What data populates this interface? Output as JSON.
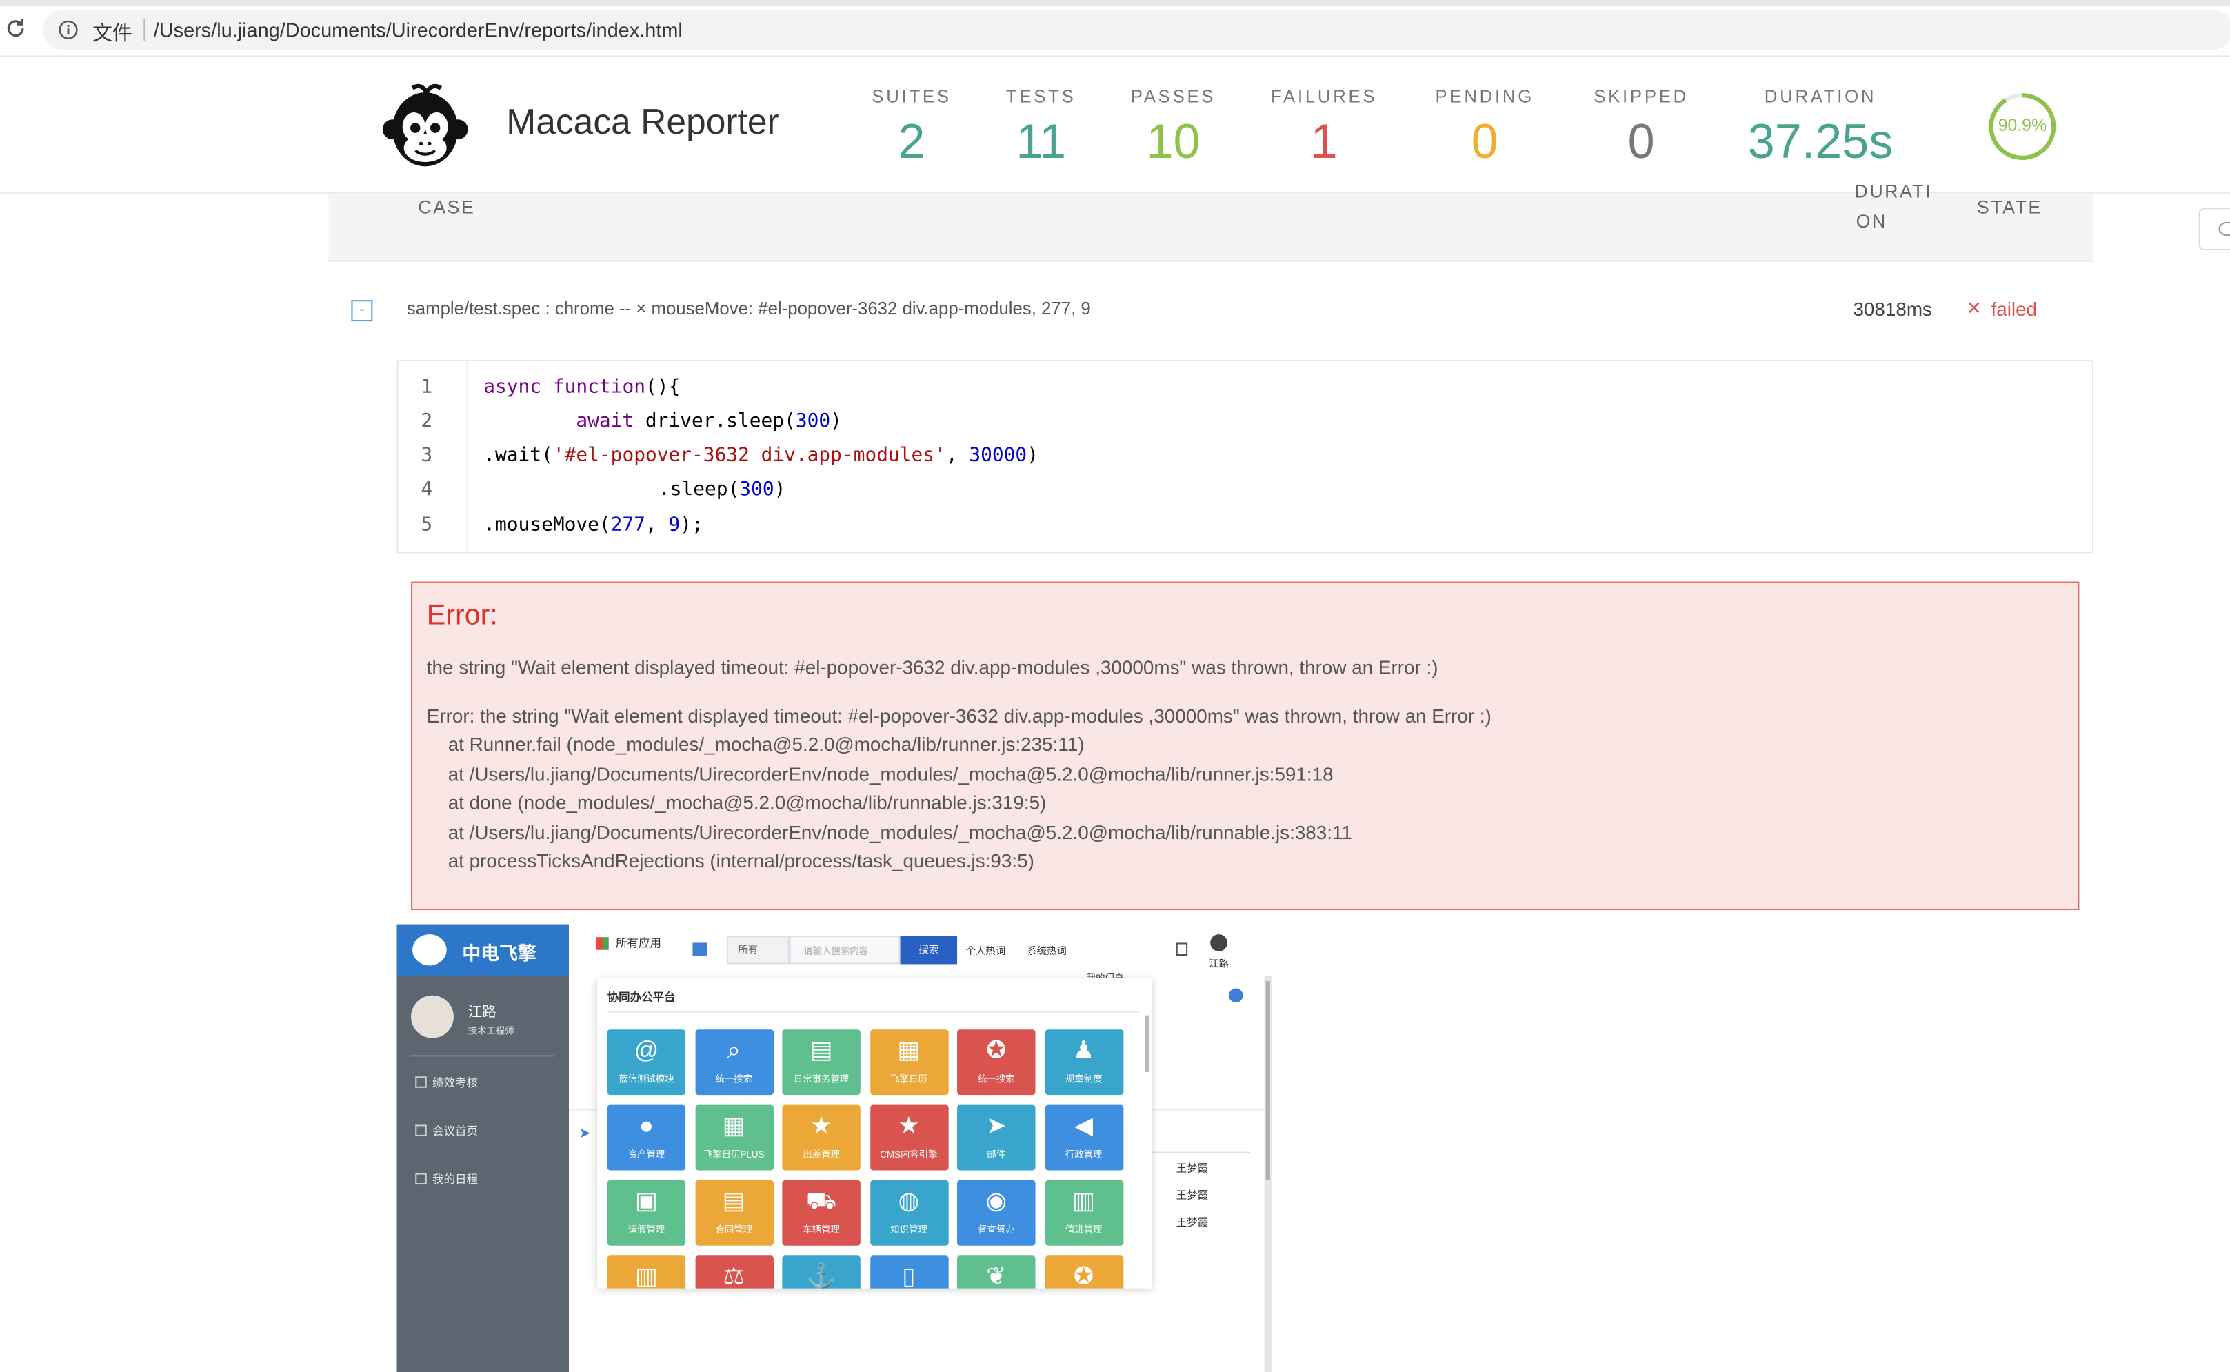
{
  "browser": {
    "file_label": "文件",
    "url": "/Users/lu.jiang/Documents/UirecorderEnv/reports/index.html"
  },
  "header": {
    "title": "Macaca Reporter",
    "stats": [
      {
        "label": "SUITES",
        "value": "2",
        "color": "#4aa38f"
      },
      {
        "label": "TESTS",
        "value": "11",
        "color": "#4aa38f"
      },
      {
        "label": "PASSES",
        "value": "10",
        "color": "#8fc24b"
      },
      {
        "label": "FAILURES",
        "value": "1",
        "color": "#d9534f"
      },
      {
        "label": "PENDING",
        "value": "0",
        "color": "#f0ad2e"
      },
      {
        "label": "SKIPPED",
        "value": "0",
        "color": "#777777"
      },
      {
        "label": "DURATION",
        "value": "37.25s",
        "color": "#4aa38f"
      }
    ],
    "pass_rate": "90.9%",
    "pass_rate_fraction": 0.909
  },
  "table": {
    "col_case": "CASE",
    "col_duration_top": "DURATI",
    "col_duration_bottom": "ON",
    "col_state": "STATE"
  },
  "test": {
    "toggle": "-",
    "title": "sample/test.spec : chrome -- × mouseMove: #el-popover-3632 div.app-modules, 277, 9",
    "duration": "30818ms",
    "state_icon": "×",
    "state": "failed"
  },
  "code": {
    "line_numbers": [
      "1",
      "2",
      "3",
      "4",
      "5"
    ],
    "l1_kw": "async",
    "l1_kw2": "function",
    "l1_rest": "(){",
    "l2_kw": "await",
    "l2_rest": " driver.sleep(",
    "l2_num": "300",
    "l2_end": ")",
    "l3_a": ".wait(",
    "l3_str": "'#el-popover-3632 div.app-modules'",
    "l3_b": ", ",
    "l3_num": "30000",
    "l3_c": ")",
    "l4_a": ".sleep(",
    "l4_num": "300",
    "l4_b": ")",
    "l5_a": ".mouseMove(",
    "l5_num1": "277",
    "l5_b": ", ",
    "l5_num2": "9",
    "l5_c": ");"
  },
  "error": {
    "heading": "Error:",
    "message": "the string \"Wait element displayed timeout: #el-popover-3632 div.app-modules ,30000ms\" was thrown, throw an Error :)",
    "stack": [
      "Error: the string \"Wait element displayed timeout: #el-popover-3632 div.app-modules ,30000ms\" was thrown, throw an Error :)",
      "    at Runner.fail (node_modules/_mocha@5.2.0@mocha/lib/runner.js:235:11)",
      "    at /Users/lu.jiang/Documents/UirecorderEnv/node_modules/_mocha@5.2.0@mocha/lib/runner.js:591:18",
      "    at done (node_modules/_mocha@5.2.0@mocha/lib/runnable.js:319:5)",
      "    at /Users/lu.jiang/Documents/UirecorderEnv/node_modules/_mocha@5.2.0@mocha/lib/runnable.js:383:11",
      "    at processTicksAndRejections (internal/process/task_queues.js:93:5)"
    ]
  },
  "app": {
    "brand": "中电飞擎",
    "user_name": "江路",
    "user_role": "技术工程师",
    "side_items": [
      "绩效考核",
      "会议首页",
      "我的日程"
    ],
    "all_apps": "所有应用",
    "search_scope": "所有",
    "search_placeholder": "请输入搜索内容",
    "search_button": "搜索",
    "hot1": "个人热词",
    "hot2": "系统热词",
    "my_portal": "我的门户",
    "top_user": "江路",
    "panel_title": "协同办公平台",
    "tiles": [
      {
        "label": "蓝信测试模块",
        "icon": "@",
        "color": "#3aa5cc"
      },
      {
        "label": "统一搜索",
        "icon": "⌕",
        "color": "#3f8fe0"
      },
      {
        "label": "日常事务管理",
        "icon": "▤",
        "color": "#5fbf8f"
      },
      {
        "label": "飞擎日历",
        "icon": "▦",
        "color": "#eba838"
      },
      {
        "label": "统一搜索",
        "icon": "✪",
        "color": "#d9534f"
      },
      {
        "label": "规章制度",
        "icon": "♟",
        "color": "#3aa5cc"
      },
      {
        "label": "资产管理",
        "icon": "●",
        "color": "#3f8fe0"
      },
      {
        "label": "飞擎日历PLUS",
        "icon": "▦",
        "color": "#5fbf8f"
      },
      {
        "label": "出差管理",
        "icon": "★",
        "color": "#eba838"
      },
      {
        "label": "CMS内容引擎",
        "icon": "★",
        "color": "#d9534f"
      },
      {
        "label": "邮件",
        "icon": "➤",
        "color": "#3aa5cc"
      },
      {
        "label": "行政管理",
        "icon": "◀",
        "color": "#3f8fe0"
      },
      {
        "label": "请假管理",
        "icon": "▣",
        "color": "#5fbf8f"
      },
      {
        "label": "合同管理",
        "icon": "▤",
        "color": "#eba838"
      },
      {
        "label": "车辆管理",
        "icon": "⛟",
        "color": "#d9534f"
      },
      {
        "label": "知识管理",
        "icon": "◍",
        "color": "#3aa5cc"
      },
      {
        "label": "督查督办",
        "icon": "◉",
        "color": "#3f8fe0"
      },
      {
        "label": "值班管理",
        "icon": "▥",
        "color": "#5fbf8f"
      },
      {
        "label": "",
        "icon": "▥",
        "color": "#eba838"
      },
      {
        "label": "",
        "icon": "⚖",
        "color": "#d9534f"
      },
      {
        "label": "",
        "icon": "⚓",
        "color": "#3aa5cc"
      },
      {
        "label": "",
        "icon": "▯",
        "color": "#3f8fe0"
      },
      {
        "label": "",
        "icon": "❦",
        "color": "#5fbf8f"
      },
      {
        "label": "",
        "icon": "✪",
        "color": "#eba838"
      }
    ],
    "right_names": [
      "王梦霞",
      "王梦霞",
      "王梦霞"
    ]
  }
}
